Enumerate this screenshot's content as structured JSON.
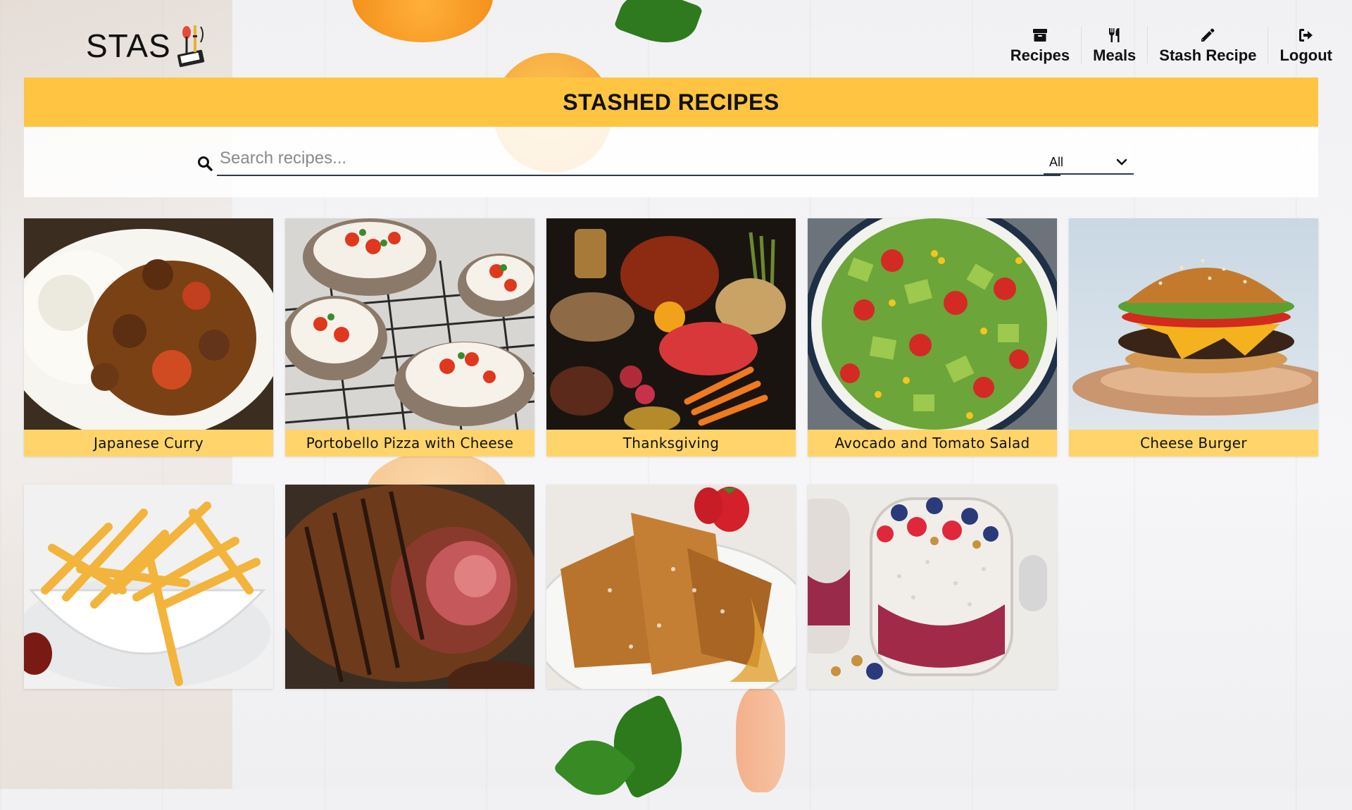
{
  "app": {
    "logo_text": "STAS"
  },
  "nav": {
    "items": [
      {
        "label": "Recipes",
        "icon": "archive-box-icon"
      },
      {
        "label": "Meals",
        "icon": "fork-knife-icon"
      },
      {
        "label": "Stash Recipe",
        "icon": "pencil-icon"
      },
      {
        "label": "Logout",
        "icon": "logout-icon"
      }
    ]
  },
  "page": {
    "title": "STASHED RECIPES"
  },
  "search": {
    "placeholder": "Search recipes...",
    "value": "",
    "filter_selected": "All"
  },
  "recipes": [
    {
      "title": "Japanese Curry",
      "image": "japanese-curry-photo"
    },
    {
      "title": "Portobello Pizza with Cheese",
      "image": "portobello-pizza-photo"
    },
    {
      "title": "Thanksgiving",
      "image": "thanksgiving-spread-photo"
    },
    {
      "title": "Avocado and Tomato Salad",
      "image": "avocado-tomato-salad-photo"
    },
    {
      "title": "Cheese Burger",
      "image": "cheese-burger-photo"
    },
    {
      "title": "",
      "image": "french-fries-photo"
    },
    {
      "title": "",
      "image": "roast-beef-photo"
    },
    {
      "title": "",
      "image": "french-toast-photo"
    },
    {
      "title": "",
      "image": "chia-pudding-photo"
    }
  ],
  "colors": {
    "accent": "#ffc542",
    "caption": "#ffd46a"
  }
}
